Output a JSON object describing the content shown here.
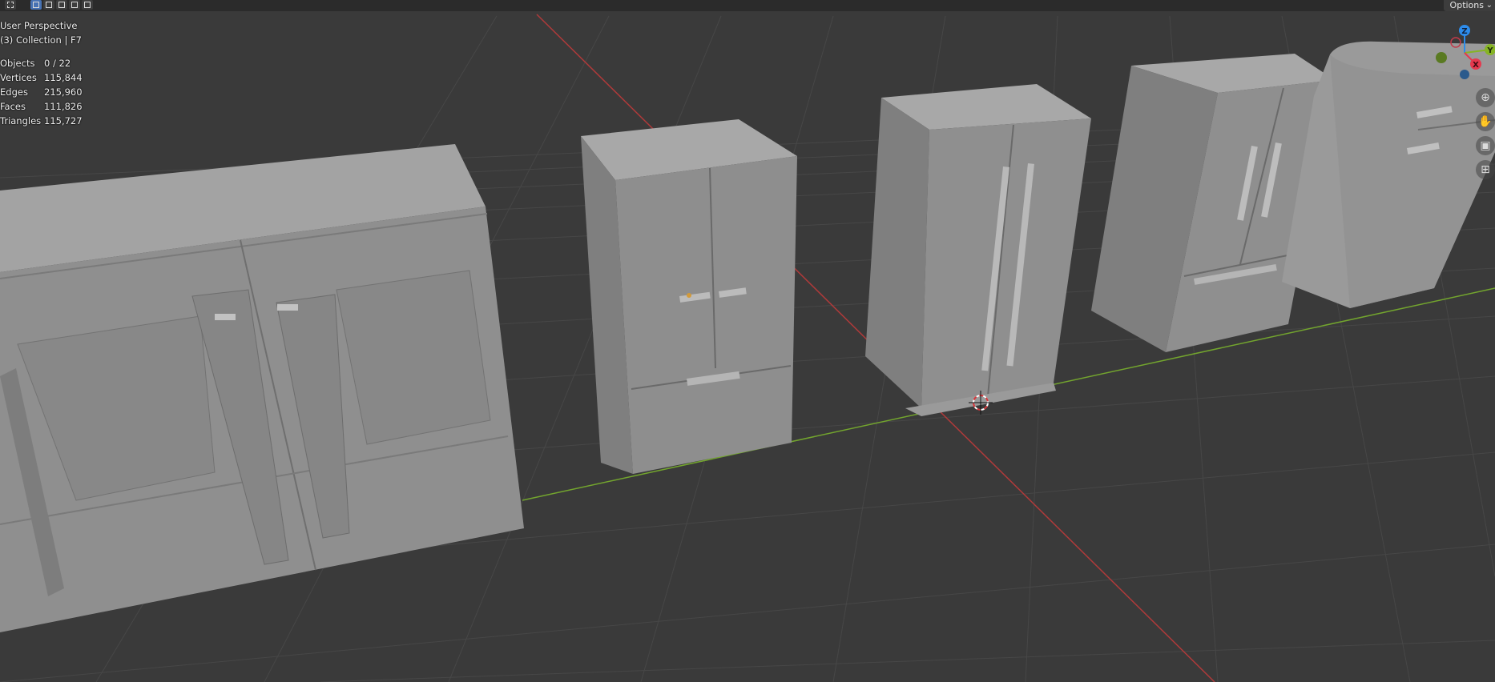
{
  "header": {
    "tools": [
      {
        "icon": "cursor-play-icon",
        "selected": false
      },
      {
        "icon": "select-box-icon",
        "selected": true
      },
      {
        "icon": "select-extend-icon",
        "selected": false
      },
      {
        "icon": "select-subtract-icon",
        "selected": false
      },
      {
        "icon": "select-intersect-icon",
        "selected": false
      }
    ],
    "options_label": "Options"
  },
  "overlay": {
    "view_name": "User Perspective",
    "collection": "(3) Collection | F7"
  },
  "stats": [
    {
      "label": "Objects",
      "value": "0 / 22"
    },
    {
      "label": "Vertices",
      "value": "115,844"
    },
    {
      "label": "Edges",
      "value": "215,960"
    },
    {
      "label": "Faces",
      "value": "111,826"
    },
    {
      "label": "Triangles",
      "value": "115,727"
    }
  ],
  "gizmo": {
    "axes": {
      "x": "X",
      "y": "Y",
      "z": "Z"
    },
    "colors": {
      "x": "#e5394e",
      "y": "#86b425",
      "z": "#2d8ceb"
    }
  },
  "nav_buttons": [
    "zoom-icon",
    "hand-pan-icon",
    "camera-icon",
    "perspective-grid-icon"
  ],
  "colors": {
    "viewport_bg": "#3a3a3a",
    "grid": "#4a4a4a",
    "x_axis": "#b33a3a",
    "y_axis": "#74a62e",
    "header_bg": "#2b2b2b",
    "model_light": "#a3a3a3",
    "model_mid": "#8c8c8c",
    "model_dark": "#6f6f6f"
  }
}
